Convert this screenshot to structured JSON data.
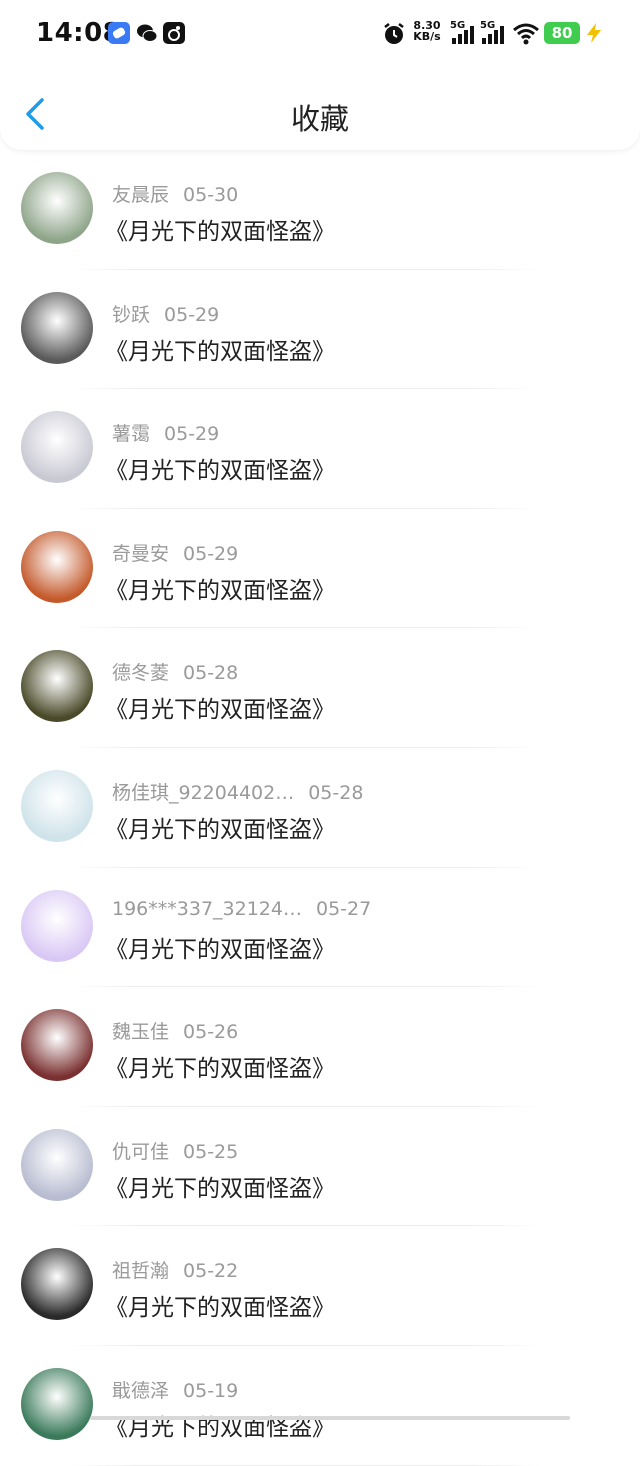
{
  "status": {
    "time": "14:08",
    "net_speed_value": "8.30",
    "net_speed_unit": "KB/s",
    "signal1_label": "5G",
    "signal2_label": "5G",
    "battery": "80",
    "colors": {
      "battery": "#3fcc4f",
      "accent": "#1e9be9"
    }
  },
  "header": {
    "title": "收藏",
    "back_icon": "chevron-left-icon"
  },
  "items": [
    {
      "name": "友晨辰",
      "date": "05-30",
      "title": "《月光下的双面怪盗》",
      "avatar_color": "#8fa58a"
    },
    {
      "name": "钞跃",
      "date": "05-29",
      "title": "《月光下的双面怪盗》",
      "avatar_color": "#5a5a5a"
    },
    {
      "name": "薯霭",
      "date": "05-29",
      "title": "《月光下的双面怪盗》",
      "avatar_color": "#c9c9d4"
    },
    {
      "name": "奇曼安",
      "date": "05-29",
      "title": "《月光下的双面怪盗》",
      "avatar_color": "#c45a2c"
    },
    {
      "name": "德冬菱",
      "date": "05-28",
      "title": "《月光下的双面怪盗》",
      "avatar_color": "#4a4a2a"
    },
    {
      "name": "杨佳琪_92204402…",
      "date": "05-28",
      "title": "《月光下的双面怪盗》",
      "avatar_color": "#cfe3ea"
    },
    {
      "name": "196***337_32124…",
      "date": "05-27",
      "title": "《月光下的双面怪盗》",
      "avatar_color": "#d9c8f5"
    },
    {
      "name": "魏玉佳",
      "date": "05-26",
      "title": "《月光下的双面怪盗》",
      "avatar_color": "#7a3030"
    },
    {
      "name": "仇可佳",
      "date": "05-25",
      "title": "《月光下的双面怪盗》",
      "avatar_color": "#b8bcd0"
    },
    {
      "name": "祖哲瀚",
      "date": "05-22",
      "title": "《月光下的双面怪盗》",
      "avatar_color": "#2a2a2a"
    },
    {
      "name": "戢德泽",
      "date": "05-19",
      "title": "《月光下的双面怪盗》",
      "avatar_color": "#3a7a5a"
    }
  ]
}
